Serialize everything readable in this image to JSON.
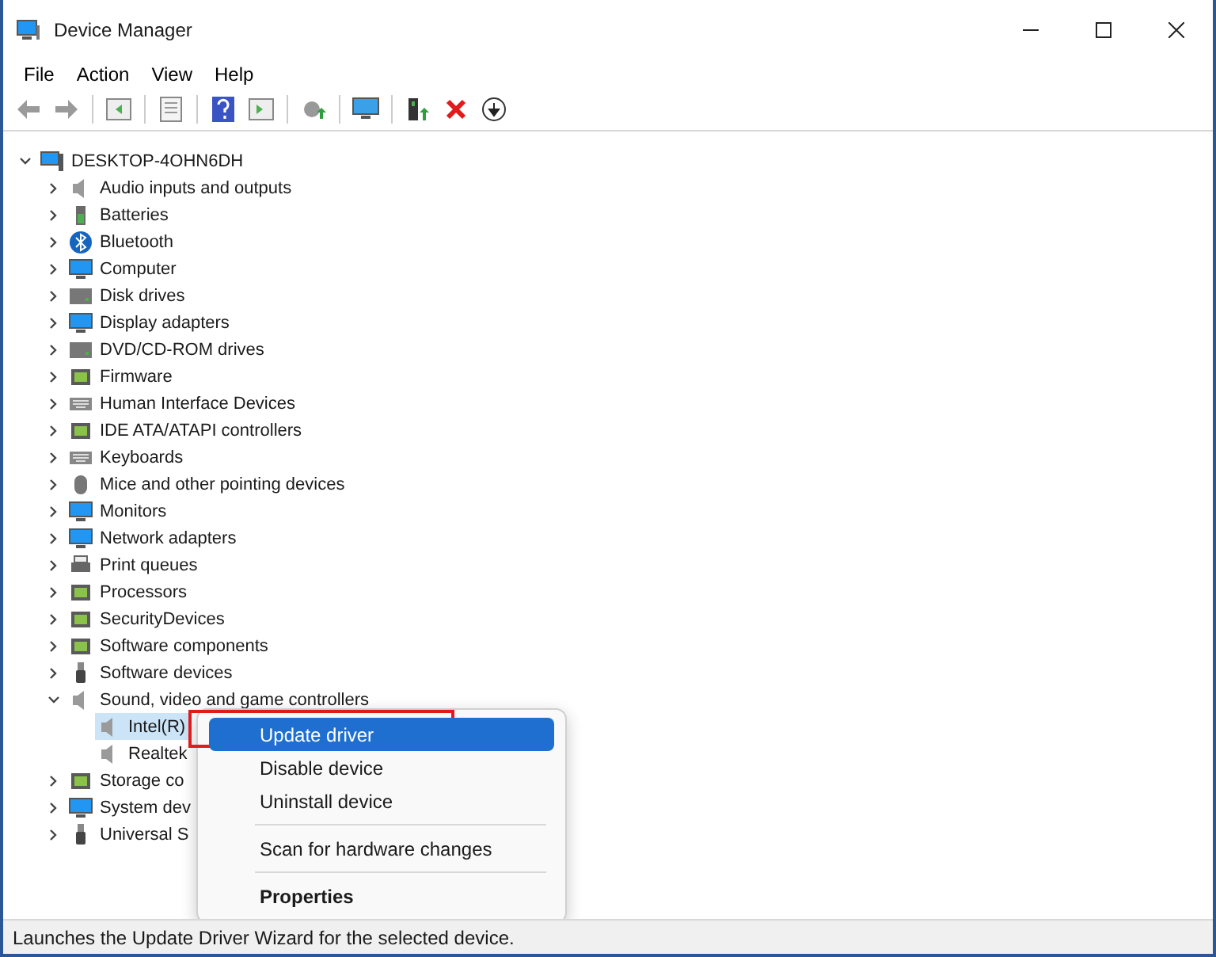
{
  "window": {
    "title": "Device Manager"
  },
  "menu_bar": [
    "File",
    "Action",
    "View",
    "Help"
  ],
  "tree": {
    "label": "DESKTOP-4OHN6DH",
    "expanded": true,
    "selected": false,
    "children": [
      {
        "label": "Audio inputs and outputs",
        "expanded": false,
        "selected": false
      },
      {
        "label": "Batteries",
        "expanded": false,
        "selected": false
      },
      {
        "label": "Bluetooth",
        "expanded": false,
        "selected": false
      },
      {
        "label": "Computer",
        "expanded": false,
        "selected": false
      },
      {
        "label": "Disk drives",
        "expanded": false,
        "selected": false
      },
      {
        "label": "Display adapters",
        "expanded": false,
        "selected": false
      },
      {
        "label": "DVD/CD-ROM drives",
        "expanded": false,
        "selected": false
      },
      {
        "label": "Firmware",
        "expanded": false,
        "selected": false
      },
      {
        "label": "Human Interface Devices",
        "expanded": false,
        "selected": false
      },
      {
        "label": "IDE ATA/ATAPI controllers",
        "expanded": false,
        "selected": false
      },
      {
        "label": "Keyboards",
        "expanded": false,
        "selected": false
      },
      {
        "label": "Mice and other pointing devices",
        "expanded": false,
        "selected": false
      },
      {
        "label": "Monitors",
        "expanded": false,
        "selected": false
      },
      {
        "label": "Network adapters",
        "expanded": false,
        "selected": false
      },
      {
        "label": "Print queues",
        "expanded": false,
        "selected": false
      },
      {
        "label": "Processors",
        "expanded": false,
        "selected": false
      },
      {
        "label": "SecurityDevices",
        "expanded": false,
        "selected": false
      },
      {
        "label": "Software components",
        "expanded": false,
        "selected": false
      },
      {
        "label": "Software devices",
        "expanded": false,
        "selected": false
      },
      {
        "label": "Sound, video and game controllers",
        "expanded": true,
        "selected": false,
        "children": [
          {
            "label": "Intel(R)",
            "selected": true
          },
          {
            "label": "Realtek",
            "selected": false
          }
        ]
      },
      {
        "label": "Storage co",
        "expanded": false,
        "selected": false
      },
      {
        "label": "System dev",
        "expanded": false,
        "selected": false
      },
      {
        "label": "Universal S",
        "expanded": false,
        "selected": false
      }
    ]
  },
  "context_menu": {
    "items": [
      {
        "kind": "item",
        "label": "Update driver",
        "selected": true,
        "bold": false,
        "outlined": true
      },
      {
        "kind": "item",
        "label": "Disable device",
        "selected": false,
        "bold": false,
        "outlined": false
      },
      {
        "kind": "item",
        "label": "Uninstall device",
        "selected": false,
        "bold": false,
        "outlined": false
      },
      {
        "kind": "separator"
      },
      {
        "kind": "item",
        "label": "Scan for hardware changes",
        "selected": false,
        "bold": false,
        "outlined": false
      },
      {
        "kind": "separator"
      },
      {
        "kind": "item",
        "label": "Properties",
        "selected": false,
        "bold": true,
        "outlined": false
      }
    ]
  },
  "status_bar": "Launches the Update Driver Wizard for the selected device."
}
